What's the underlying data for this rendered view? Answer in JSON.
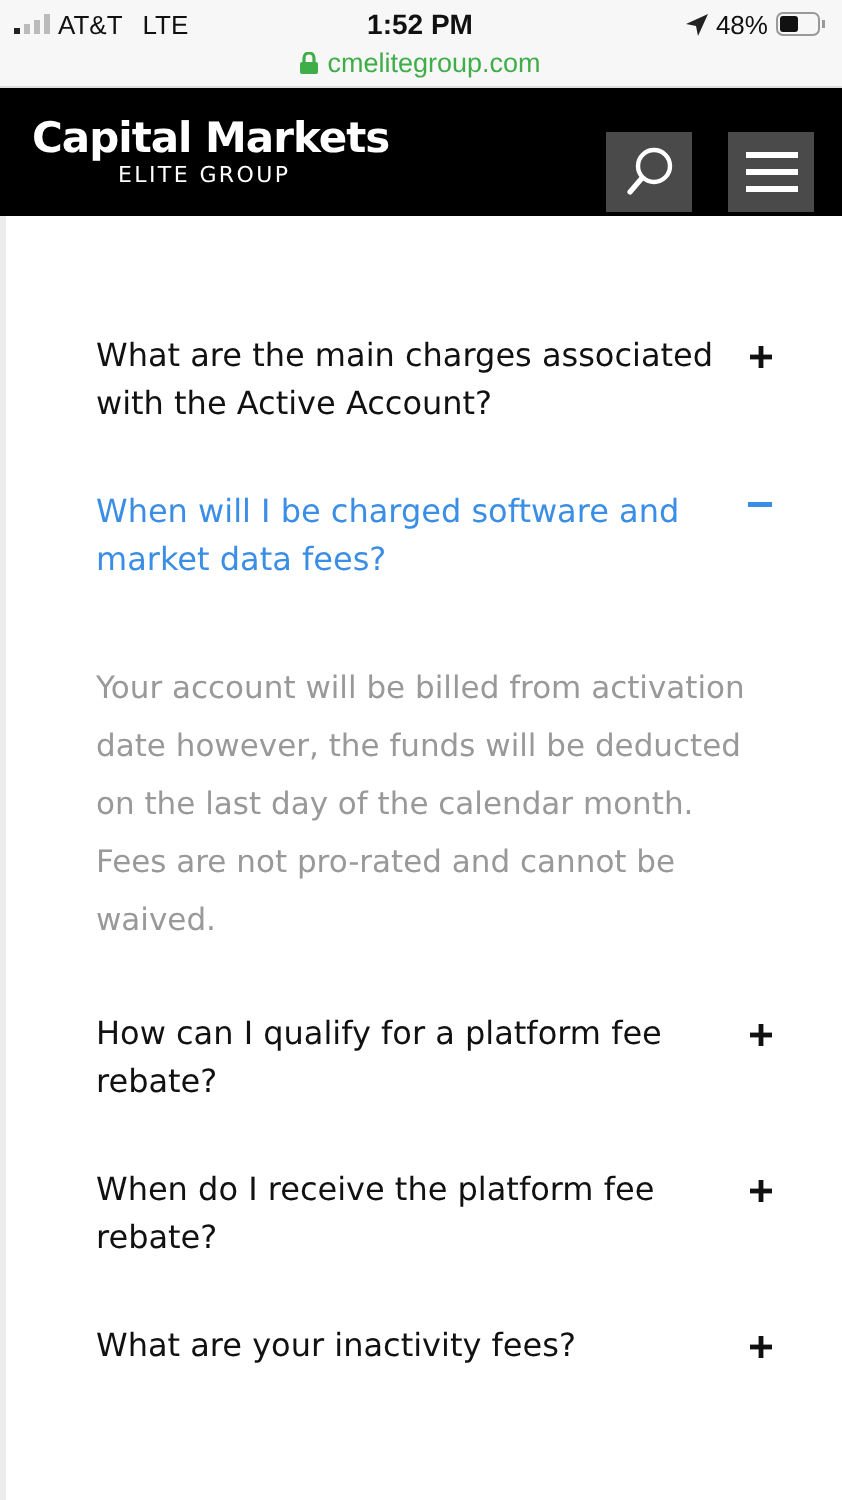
{
  "status_bar": {
    "carrier": "AT&T",
    "network": "LTE",
    "time": "1:52 PM",
    "battery": "48%",
    "url": "cmelitegroup.com"
  },
  "header": {
    "logo_title": "Capital Markets",
    "logo_subtitle": "ELITE GROUP"
  },
  "faq": [
    {
      "question": "What are the main charges associated with the Active Account?",
      "expanded": false
    },
    {
      "question": "When will I be charged software and market data fees?",
      "expanded": true,
      "answer": "Your account will be billed from activation date however, the funds will be deducted on the last day of the calendar month. Fees are not pro-rated and cannot be waived."
    },
    {
      "question": "How can I qualify for a platform fee rebate?",
      "expanded": false
    },
    {
      "question": "When do I receive the platform fee rebate?",
      "expanded": false
    },
    {
      "question": "What are your inactivity fees?",
      "expanded": false
    }
  ]
}
